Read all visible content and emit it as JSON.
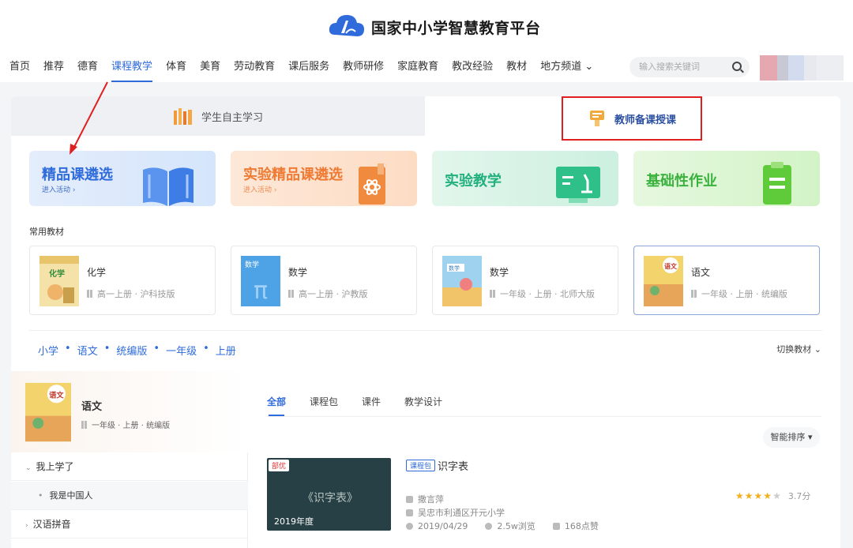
{
  "header": {
    "logo_text": "国家中小学智慧教育平台",
    "nav": [
      "首页",
      "推荐",
      "德育",
      "课程教学",
      "体育",
      "美育",
      "劳动教育",
      "课后服务",
      "教师研修",
      "家庭教育",
      "教改经验",
      "教材",
      "地方频道 ⌄"
    ],
    "active_nav": "课程教学",
    "search_placeholder": "输入搜索关键词"
  },
  "tabs": {
    "left": "学生自主学习",
    "right": "教师备课授课"
  },
  "features": [
    {
      "title": "精品课遴选",
      "subtitle": "进入活动 ›",
      "color": "#2f6bdb"
    },
    {
      "title": "实验精品课遴选",
      "subtitle": "进入活动 ›",
      "color": "#f07a33"
    },
    {
      "title": "实验教学",
      "subtitle": "",
      "color": "#22b07d"
    },
    {
      "title": "基础性作业",
      "subtitle": "",
      "color": "#35b53d"
    }
  ],
  "common_books_label": "常用教材",
  "books": [
    {
      "name": "化学",
      "meta": "高一上册 · 沪科技版"
    },
    {
      "name": "数学",
      "meta": "高一上册 · 沪教版"
    },
    {
      "name": "数学",
      "meta": "一年级 · 上册 · 北师大版"
    },
    {
      "name": "语文",
      "meta": "一年级 · 上册 · 统编版"
    }
  ],
  "breadcrumb": [
    "小学",
    "•",
    "语文",
    "•",
    "统编版",
    "•",
    "一年级",
    "•",
    "上册"
  ],
  "switch_label": "切换教材 ⌄",
  "sidebar": {
    "book_title": "语文",
    "book_meta": "一年级 · 上册 · 统编版",
    "items": [
      {
        "label": "我上学了"
      },
      {
        "label": "我是中国人"
      },
      {
        "label": "汉语拼音"
      }
    ]
  },
  "content_tabs": [
    "全部",
    "课程包",
    "课件",
    "教学设计"
  ],
  "sort_label": "智能排序 ▾",
  "resource": {
    "badge": "部优",
    "thumb_text": "《识字表》",
    "thumb_year": "2019年度",
    "type_tag": "课程包",
    "title": "识字表",
    "teacher": "撒言萍",
    "school": "吴忠市利通区开元小学",
    "date": "2019/04/29",
    "views": "2.5w浏览",
    "likes": "168点赞",
    "rating": 3.7,
    "rating_label": "3.7分"
  }
}
